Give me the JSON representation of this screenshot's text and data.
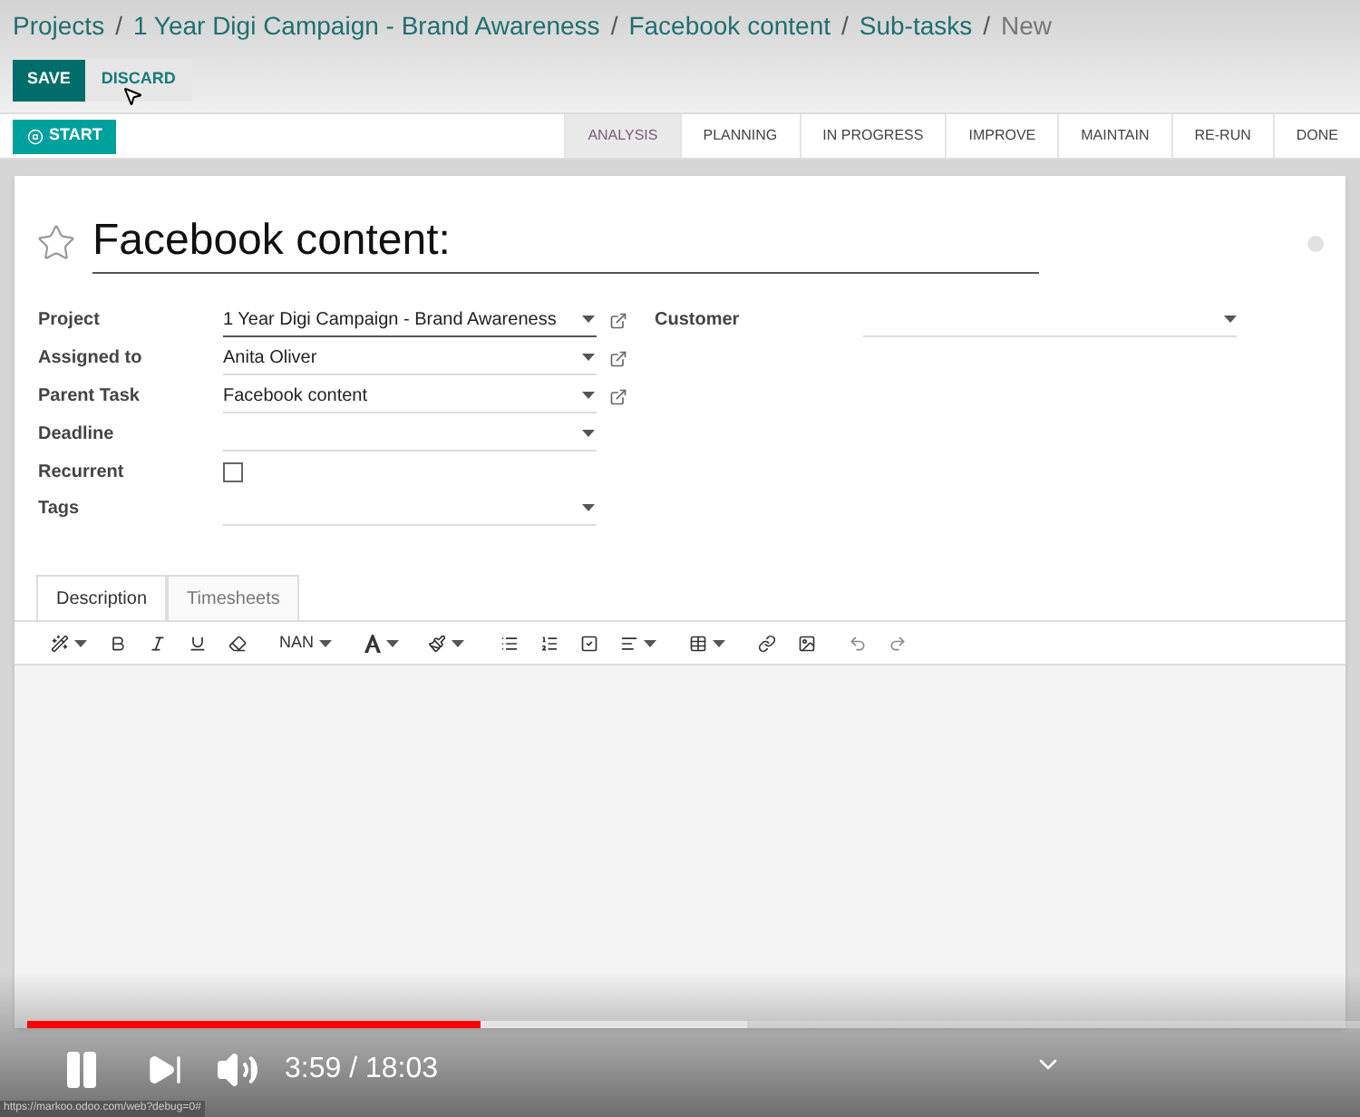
{
  "breadcrumb": [
    {
      "label": "Projects",
      "kind": "link"
    },
    {
      "label": "/",
      "kind": "separator"
    },
    {
      "label": "1 Year Digi Campaign - Brand Awareness",
      "kind": "link"
    },
    {
      "label": "/",
      "kind": "separator"
    },
    {
      "label": "Facebook content",
      "kind": "link"
    },
    {
      "label": "/",
      "kind": "separator"
    },
    {
      "label": "Sub-tasks",
      "kind": "link"
    },
    {
      "label": "/",
      "kind": "separator"
    },
    {
      "label": "New",
      "kind": "current"
    }
  ],
  "actions": {
    "save": "SAVE",
    "discard": "DISCARD"
  },
  "start_button": "START",
  "stages": [
    {
      "label": "ANALYSIS",
      "selected": true
    },
    {
      "label": "PLANNING",
      "selected": false
    },
    {
      "label": "IN PROGRESS",
      "selected": false
    },
    {
      "label": "IMPROVE",
      "selected": false
    },
    {
      "label": "MAINTAIN",
      "selected": false
    },
    {
      "label": "RE-RUN",
      "selected": false
    },
    {
      "label": "DONE",
      "selected": false
    }
  ],
  "title": {
    "value": "Facebook content:",
    "starred": false
  },
  "fields": [
    {
      "label": "Project",
      "kind": "dropdown",
      "value": "1 Year Digi Campaign - Brand Awareness",
      "external_link": true,
      "focused": true
    },
    {
      "label": "Assigned to",
      "kind": "dropdown",
      "value": "Anita Oliver",
      "external_link": true,
      "focused": false
    },
    {
      "label": "Parent Task",
      "kind": "dropdown",
      "value": "Facebook content",
      "external_link": true,
      "focused": false
    },
    {
      "label": "Deadline",
      "kind": "dropdown",
      "external_link": false,
      "focused": false
    },
    {
      "label": "Recurrent",
      "kind": "checkbox",
      "checked": false
    },
    {
      "label": "Tags",
      "kind": "dropdown",
      "external_link": false,
      "focused": false
    }
  ],
  "customer": {
    "label": "Customer"
  },
  "tabs": [
    {
      "label": "Description",
      "selected": true
    },
    {
      "label": "Timesheets",
      "selected": false
    }
  ],
  "toolbar": {
    "font_size": "NAN"
  },
  "player": {
    "progress": {
      "level": 0.34
    },
    "time": "3:59 / 18:03",
    "status_url": "https://markoo.odoo.com/web?debug=0#"
  }
}
